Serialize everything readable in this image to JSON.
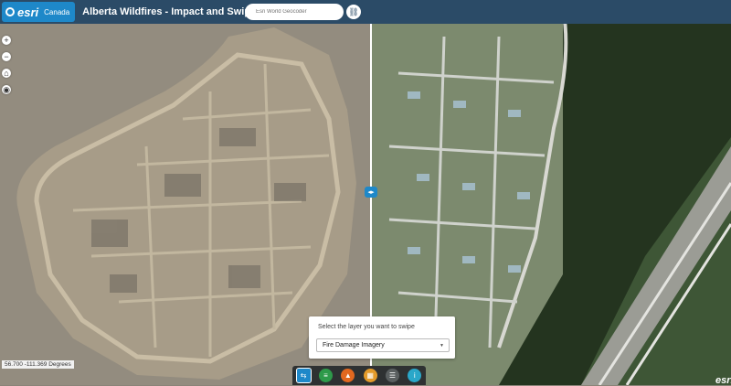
{
  "header": {
    "logo_text": "esri",
    "logo_sub": "Canada",
    "title": "Alberta Wildfires - Impact and Swipe App"
  },
  "search": {
    "placeholder": "Esri World Geocoder"
  },
  "map": {
    "coords": "56.700 -111.369 Degrees",
    "watermark": "esri"
  },
  "swipe_panel": {
    "label": "Select the layer you want to swipe",
    "selected": "Fire Damage Imagery"
  },
  "icons": {
    "zoom_in": "plus-icon",
    "zoom_out": "minus-icon",
    "home": "home-icon",
    "locate": "locate-icon",
    "search_btn": "link-icon",
    "swipe_handle": "swipe-icon",
    "toolbar": [
      "swipe-tool-icon",
      "layers-icon",
      "basemap-icon",
      "grid-icon",
      "list-icon",
      "info-icon"
    ]
  },
  "colors": {
    "header": "#2b4b67",
    "accent": "#1e88c9",
    "toolbar": "#2e3132"
  }
}
